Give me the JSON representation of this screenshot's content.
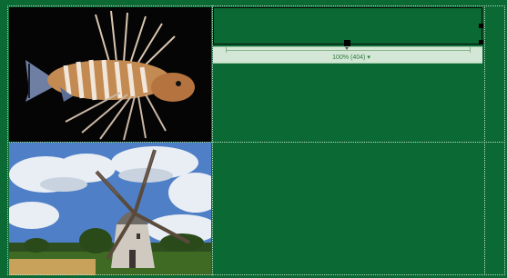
{
  "document": {
    "table_width_label": "100% (404)",
    "dropdown_arrow": "▾"
  },
  "images": [
    {
      "name": "lionfish-photo",
      "subject": "lionfish"
    },
    {
      "name": "windmill-photo",
      "subject": "windmill"
    }
  ],
  "colors": {
    "table_background": "#0b6a33",
    "ruler_band": "#d4e7d6",
    "guide_lines": "#dcebe1"
  }
}
